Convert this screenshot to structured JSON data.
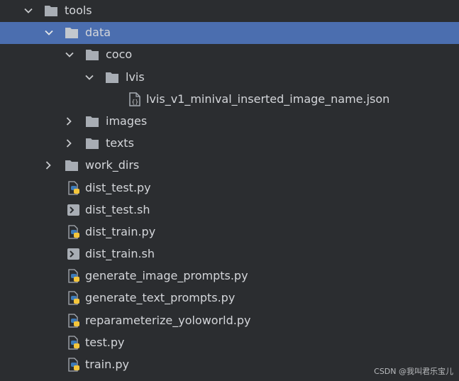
{
  "tree": {
    "items": [
      {
        "label": "tools",
        "type": "folder",
        "expanded": true,
        "selected": false
      },
      {
        "label": "data",
        "type": "folder",
        "expanded": true,
        "selected": true
      },
      {
        "label": "coco",
        "type": "folder",
        "expanded": true,
        "selected": false
      },
      {
        "label": "lvis",
        "type": "folder",
        "expanded": true,
        "selected": false
      },
      {
        "label": "lvis_v1_minival_inserted_image_name.json",
        "type": "json-file",
        "selected": false
      },
      {
        "label": "images",
        "type": "folder",
        "expanded": false,
        "selected": false
      },
      {
        "label": "texts",
        "type": "folder",
        "expanded": false,
        "selected": false
      },
      {
        "label": "work_dirs",
        "type": "folder",
        "expanded": false,
        "selected": false
      },
      {
        "label": "dist_test.py",
        "type": "python-file",
        "selected": false
      },
      {
        "label": "dist_test.sh",
        "type": "shell-file",
        "selected": false
      },
      {
        "label": "dist_train.py",
        "type": "python-file",
        "selected": false
      },
      {
        "label": "dist_train.sh",
        "type": "shell-file",
        "selected": false
      },
      {
        "label": "generate_image_prompts.py",
        "type": "python-file",
        "selected": false
      },
      {
        "label": "generate_text_prompts.py",
        "type": "python-file",
        "selected": false
      },
      {
        "label": "reparameterize_yoloworld.py",
        "type": "python-file",
        "selected": false
      },
      {
        "label": "test.py",
        "type": "python-file",
        "selected": false
      },
      {
        "label": "train.py",
        "type": "python-file",
        "selected": false
      }
    ]
  },
  "watermark": "CSDN @我叫君乐宝儿",
  "colors": {
    "background": "#2b2d30",
    "selection": "#4b6eaf",
    "folder": "#a8adb4",
    "python_blue": "#3d7ab8",
    "python_yellow": "#f4c53a"
  }
}
